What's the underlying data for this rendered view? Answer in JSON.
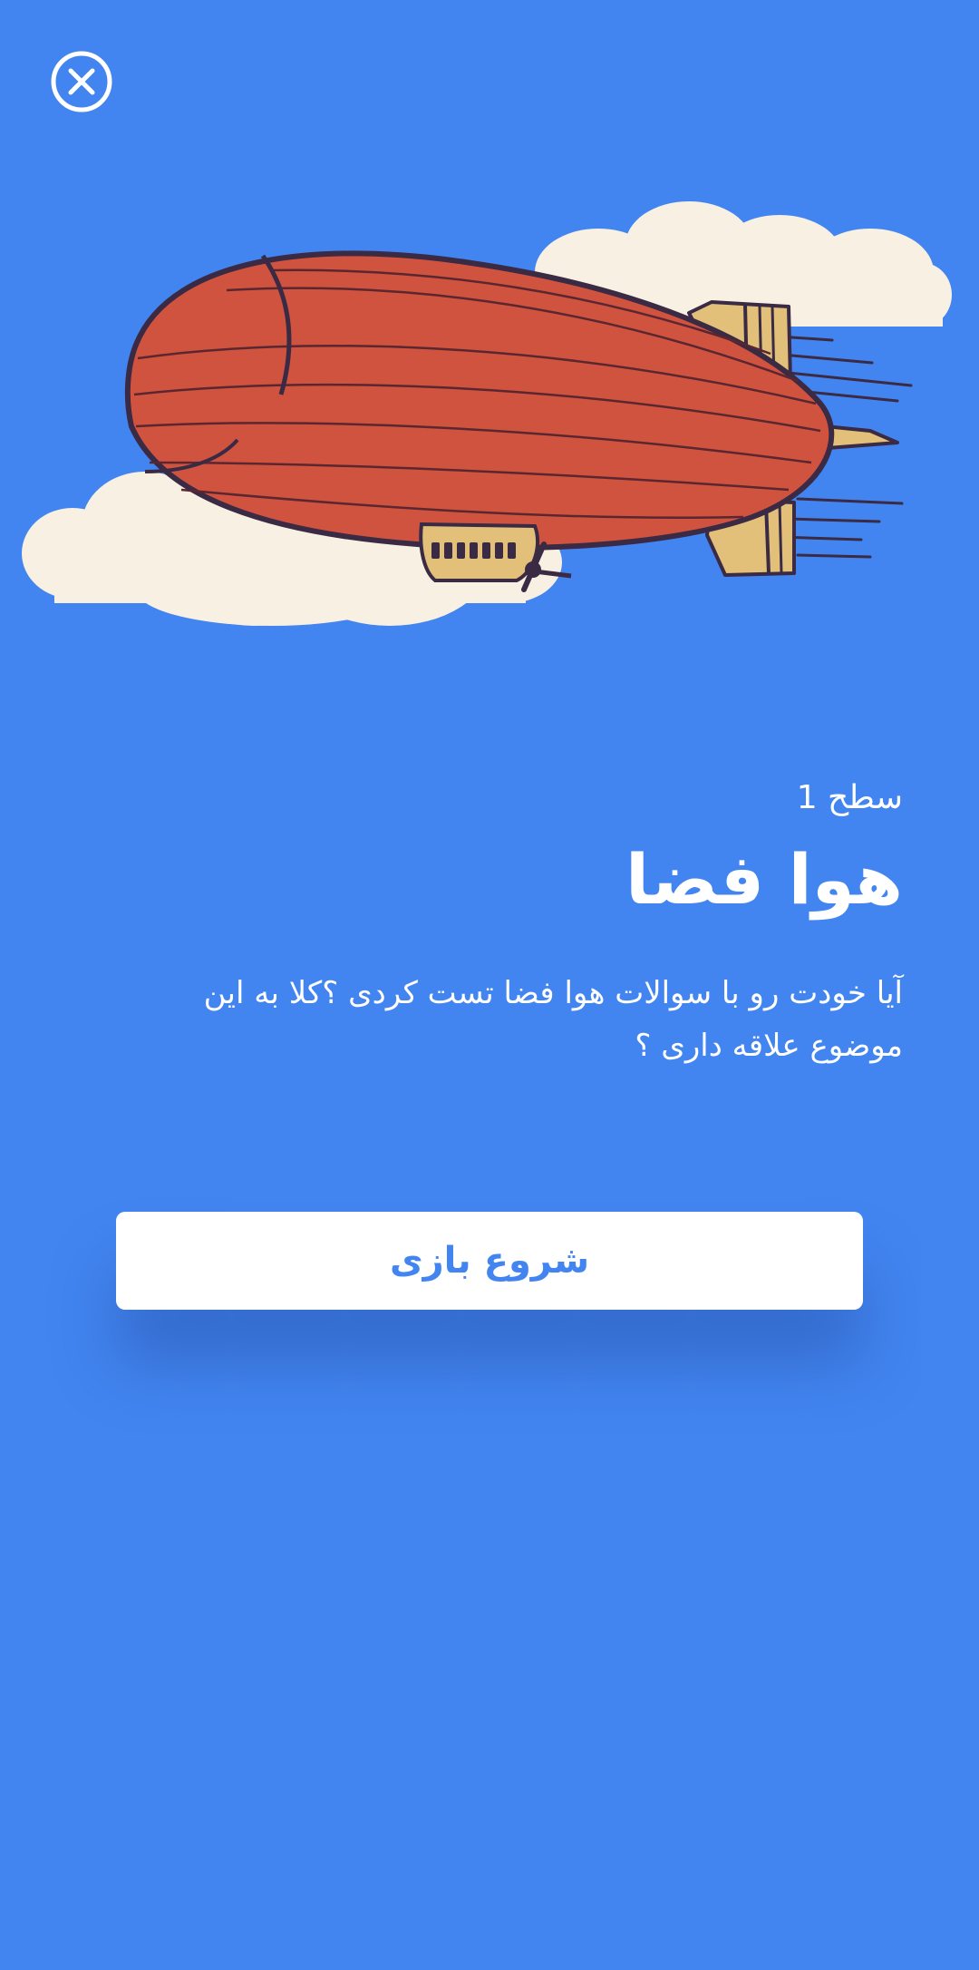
{
  "close_button": {
    "icon": "close-circle-icon"
  },
  "illustration": {
    "subject": "airship-icon"
  },
  "level": {
    "label": "سطح 1"
  },
  "title": "هوا فضا",
  "description": "آیا خودت رو با سوالات هوا فضا تست کردی ؟کلا به این موضوع علاقه داری ؟",
  "start_button": {
    "label": "شروع بازی"
  },
  "colors": {
    "background": "#4285F0",
    "button_text": "#4285F0",
    "text": "#FFFFFF",
    "balloon": "#D05340",
    "cloud": "#F8F0E3",
    "fins": "#E2C07A"
  }
}
